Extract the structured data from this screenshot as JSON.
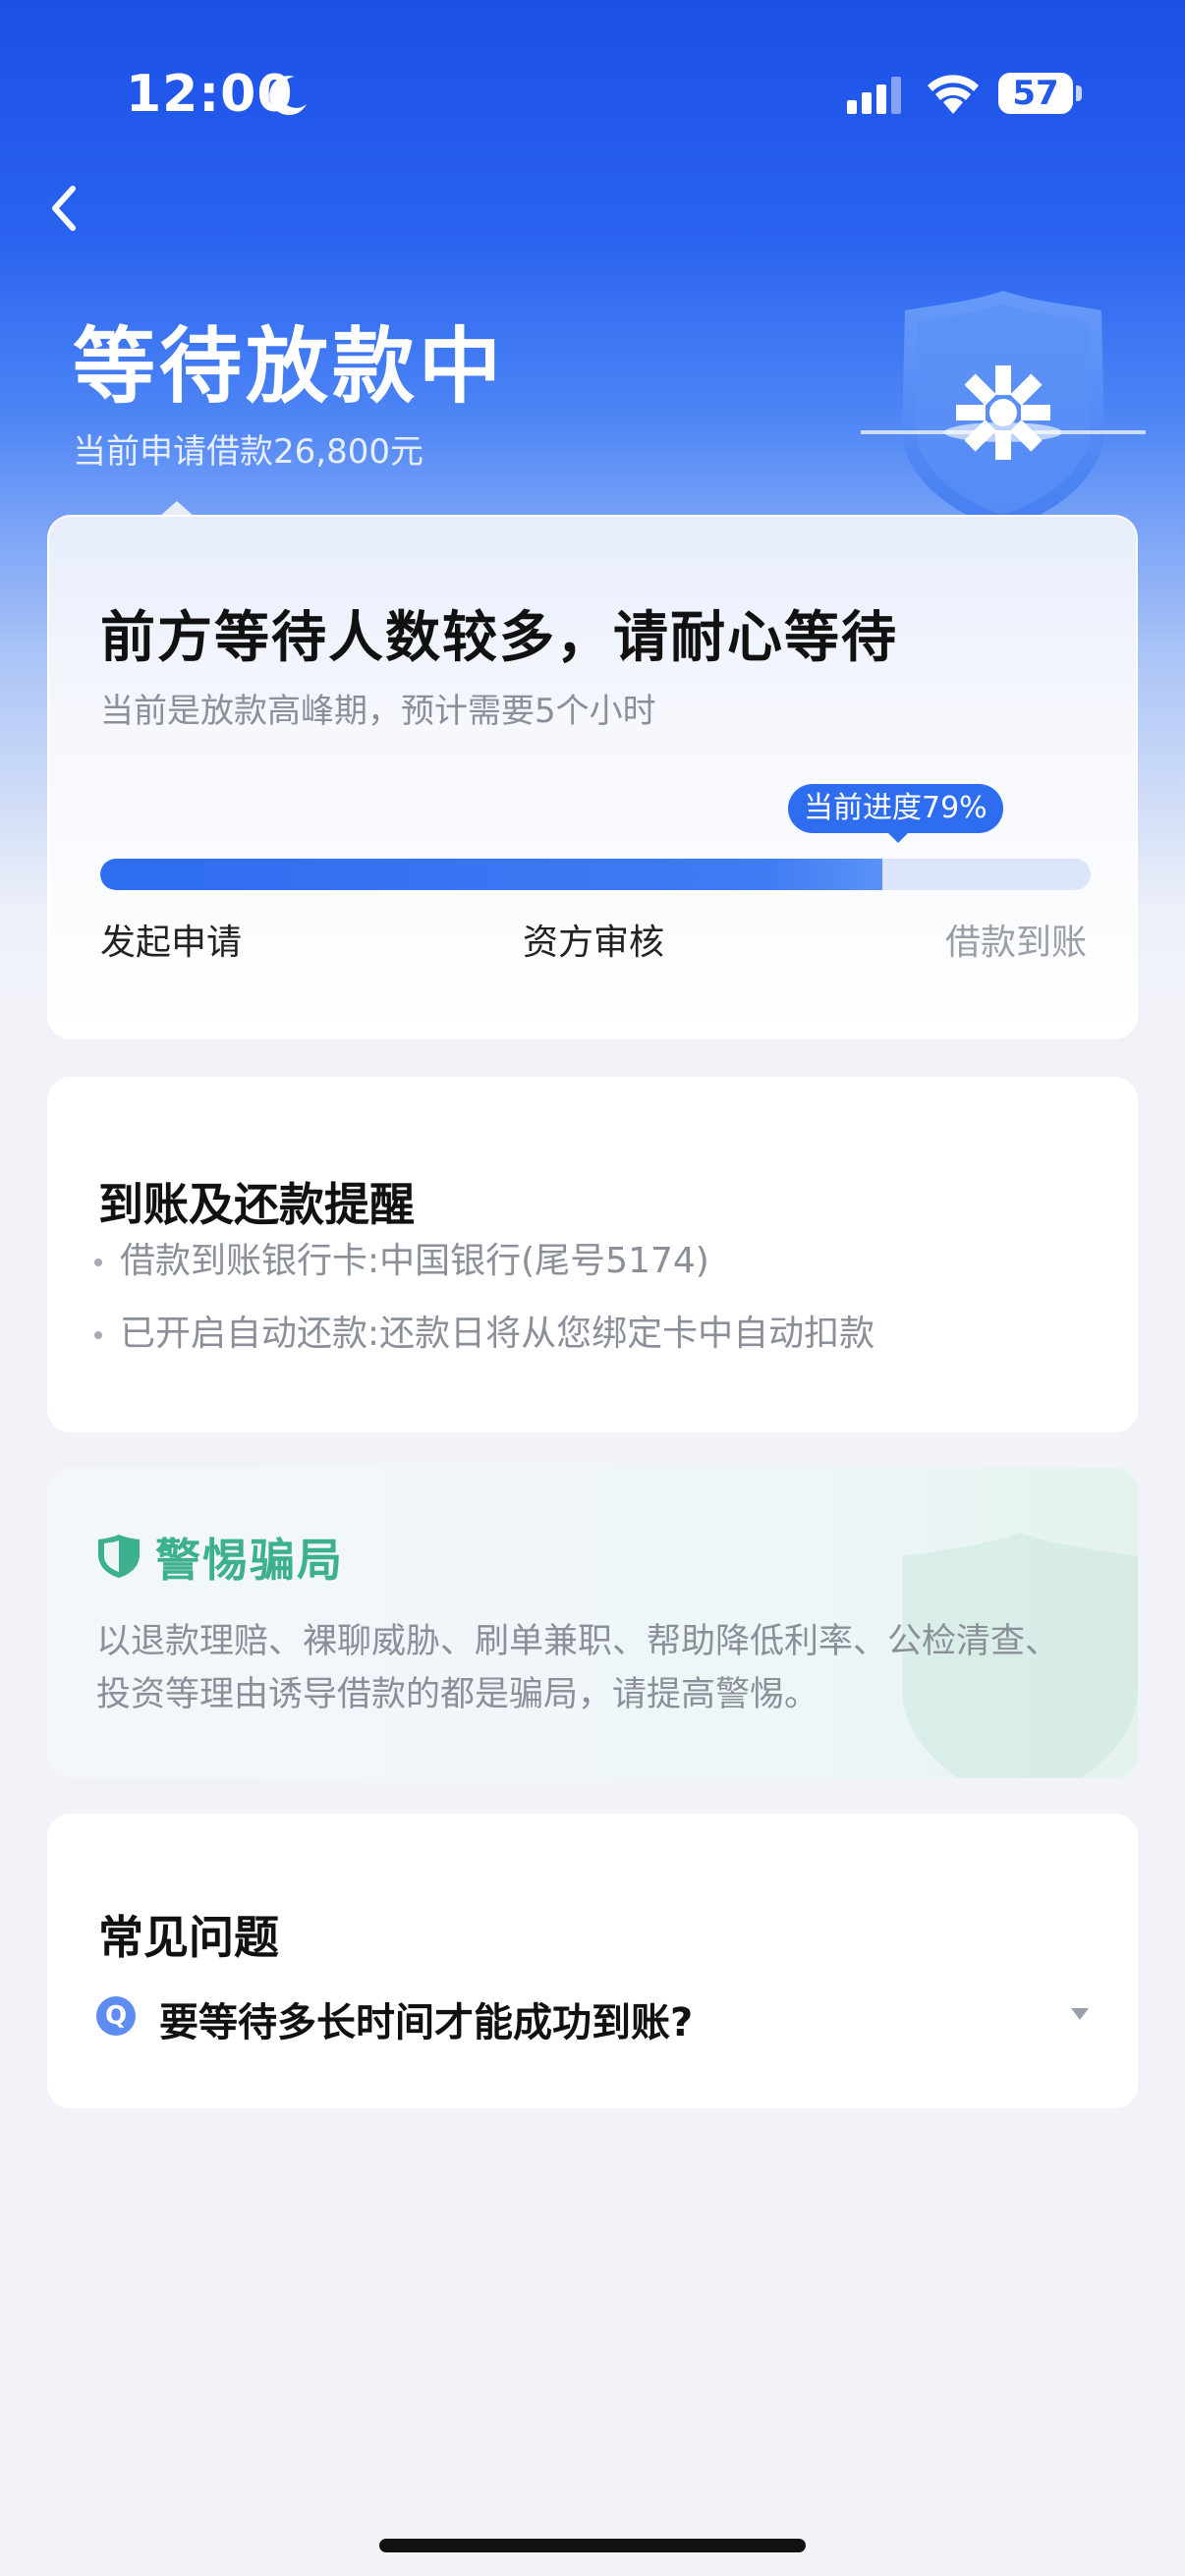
{
  "status_bar": {
    "time": "12:00",
    "battery": "57"
  },
  "header": {
    "title": "等待放款中",
    "subtitle": "当前申请借款26,800元"
  },
  "progress_card": {
    "title": "前方等待人数较多，请耐心等待",
    "subtitle": "当前是放款高峰期，预计需要5个小时",
    "progress_label": "当前进度79%",
    "progress_fraction": 0.79,
    "steps": [
      "发起申请",
      "资方审核",
      "借款到账"
    ]
  },
  "reminder_card": {
    "title": "到账及还款提醒",
    "items": [
      "借款到账银行卡:中国银行(尾号5174)",
      "已开启自动还款:还款日将从您绑定卡中自动扣款"
    ]
  },
  "fraud_card": {
    "title": "警惕骗局",
    "text": "以退款理赔、裸聊威胁、刷单兼职、帮助降低利率、公检清查、投资等理由诱导借款的都是骗局，请提高警惕。"
  },
  "faq_card": {
    "title": "常见问题",
    "badge": "Q",
    "question": "要等待多长时间才能成功到账?"
  },
  "icons": {
    "back": "chevron-left-icon",
    "moon": "moon-icon",
    "signal": "cellular-signal-icon",
    "wifi": "wifi-icon",
    "shield": "shield-icon",
    "expand": "caret-down-icon"
  },
  "colors": {
    "brand_blue": "#2e6cf0",
    "fraud_green": "#3db090"
  }
}
